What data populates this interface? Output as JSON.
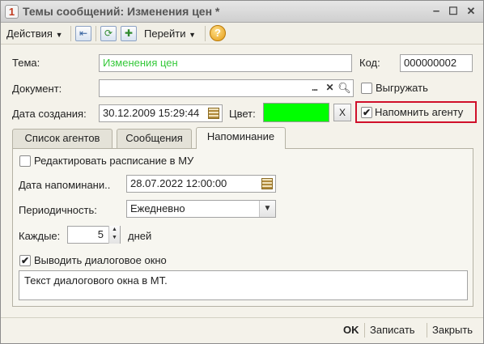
{
  "window": {
    "title": "Темы сообщений: Изменения цен *",
    "minimize_glyph": "–",
    "maximize_glyph": "☐",
    "close_glyph": "✕",
    "app_icon": "1c-logo-icon"
  },
  "toolbar": {
    "actions_label": "Действия",
    "goto_label": "Перейти",
    "icons": [
      "back-arrow-icon",
      "refresh-icon",
      "new-copy-icon",
      "help-icon"
    ]
  },
  "form": {
    "topic_label": "Тема:",
    "topic_value": "Изменения цен",
    "topic_color": "#35c93a",
    "code_label": "Код:",
    "code_value": "000000002",
    "document_label": "Документ:",
    "document_value": "",
    "unload_label": "Выгружать",
    "unload_checked": false,
    "created_label": "Дата создания:",
    "created_value": "30.12.2009 15:29:44",
    "color_label": "Цвет:",
    "color_value": "#00ff00",
    "color_clear_label": "X",
    "remind_agent_label": "Напомнить агенту",
    "remind_agent_checked": true,
    "highlight_color": "#d0102a"
  },
  "tabs": [
    {
      "label": "Список агентов",
      "active": false
    },
    {
      "label": "Сообщения",
      "active": false
    },
    {
      "label": "Напоминание",
      "active": true
    }
  ],
  "reminder": {
    "edit_schedule_label": "Редактировать расписание в МУ",
    "edit_schedule_checked": false,
    "reminder_date_label": "Дата напоминани..",
    "reminder_date_value": "28.07.2022 12:00:00",
    "periodicity_label": "Периодичность:",
    "periodicity_value": "Ежедневно",
    "every_label": "Каждые:",
    "every_value": "5",
    "every_unit": "дней",
    "show_dialog_label": "Выводить диалоговое окно",
    "show_dialog_checked": true,
    "dialog_text": "Текст диалогового окна в МТ."
  },
  "bottom": {
    "ok_label": "OK",
    "save_label": "Записать",
    "close_label": "Закрыть"
  }
}
